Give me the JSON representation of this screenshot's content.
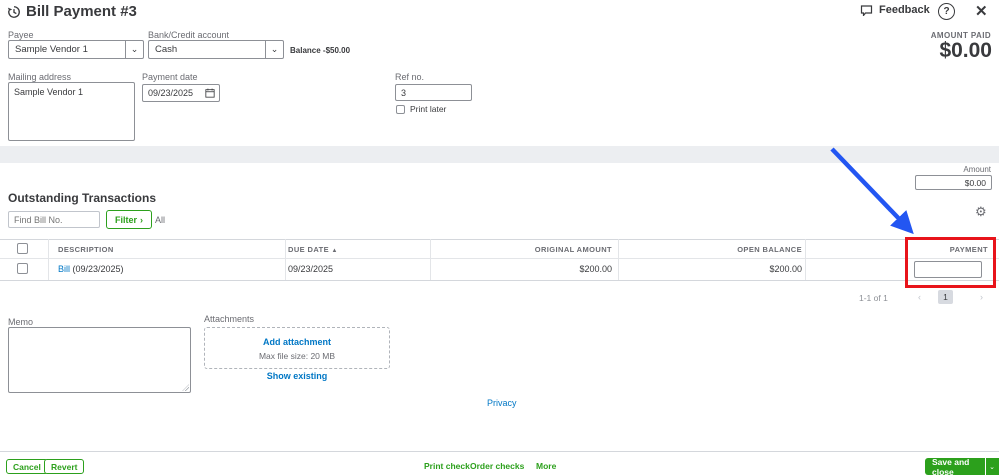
{
  "header": {
    "title": "Bill Payment #3",
    "feedback": "Feedback",
    "help": "?",
    "close": "✕",
    "amount_paid_label": "AMOUNT PAID",
    "amount_paid_value": "$0.00"
  },
  "form": {
    "payee_label": "Payee",
    "payee_value": "Sample Vendor 1",
    "bank_label": "Bank/Credit account",
    "bank_value": "Cash",
    "balance_text": "Balance -$50.00",
    "mailing_label": "Mailing address",
    "mailing_value": "Sample Vendor 1",
    "payment_date_label": "Payment date",
    "payment_date_value": "09/23/2025",
    "ref_label": "Ref no.",
    "ref_value": "3",
    "print_later_label": "Print later",
    "amount_label": "Amount",
    "amount_value": "$0.00"
  },
  "transactions": {
    "heading": "Outstanding Transactions",
    "find_placeholder": "Find Bill No.",
    "filter_label": "Filter",
    "filter_chevron": "›",
    "all_label": "All",
    "sort_arrow": "▲",
    "columns": [
      "DESCRIPTION",
      "DUE DATE",
      "ORIGINAL AMOUNT",
      "OPEN BALANCE",
      "PAYMENT"
    ],
    "rows": [
      {
        "description_link": "Bill",
        "description_rest": " (09/23/2025)",
        "due_date": "09/23/2025",
        "original_amount": "$200.00",
        "open_balance": "$200.00",
        "payment_value": ""
      }
    ],
    "pagination": {
      "range": "1-1 of 1",
      "prev": "‹",
      "page": "1",
      "next": "›"
    }
  },
  "memo": {
    "label": "Memo",
    "value": ""
  },
  "attachments": {
    "label": "Attachments",
    "add_label": "Add attachment",
    "max_size": "Max file size: 20 MB",
    "show_existing": "Show existing"
  },
  "privacy_label": "Privacy",
  "footer": {
    "cancel": "Cancel",
    "revert": "Revert",
    "print_check": "Print check",
    "order_checks": "Order checks",
    "more": "More",
    "save_and_close": "Save and close",
    "save_dropdown": "⌄"
  },
  "colors": {
    "brand_green": "#2ca01c",
    "link_blue": "#0077c5",
    "highlight_red": "#e8141b",
    "arrow_blue": "#2356f2"
  }
}
